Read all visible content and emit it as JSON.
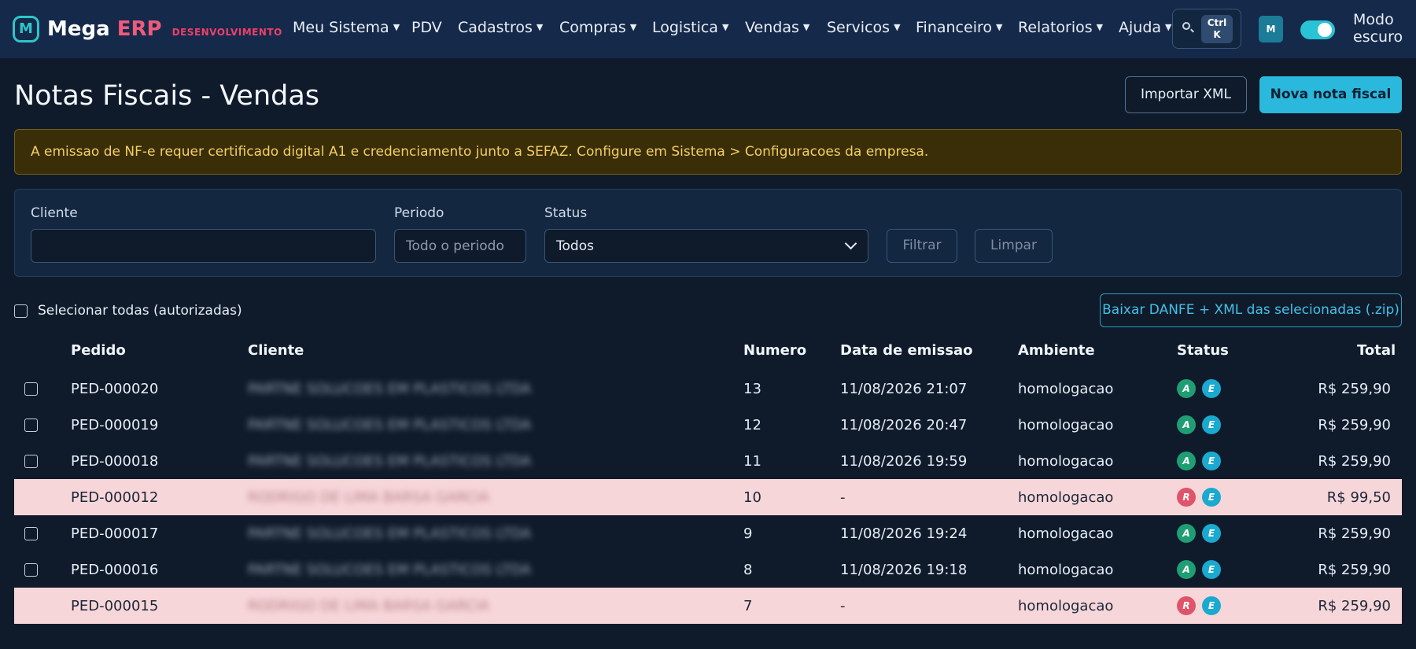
{
  "nav": {
    "brand_main": "Mega",
    "brand_erp": "ERP",
    "brand_env": "DESENVOLVIMENTO",
    "items": [
      {
        "label": "Meu Sistema",
        "dropdown": true
      },
      {
        "label": "PDV",
        "dropdown": false
      },
      {
        "label": "Cadastros",
        "dropdown": true
      },
      {
        "label": "Compras",
        "dropdown": true
      },
      {
        "label": "Logistica",
        "dropdown": true
      },
      {
        "label": "Vendas",
        "dropdown": true
      },
      {
        "label": "Servicos",
        "dropdown": true
      },
      {
        "label": "Financeiro",
        "dropdown": true
      },
      {
        "label": "Relatorios",
        "dropdown": true
      },
      {
        "label": "Ajuda",
        "dropdown": true
      }
    ],
    "shortcut_line1": "Ctrl",
    "shortcut_line2": "K",
    "avatar": "M",
    "dark_mode_label": "Modo escuro",
    "dark_mode_on": true
  },
  "header": {
    "title": "Notas Fiscais - Vendas",
    "import_button": "Importar XML",
    "new_button": "Nova nota fiscal"
  },
  "alert": {
    "text": "A emissao de NF-e requer certificado digital A1 e credenciamento junto a SEFAZ. Configure em Sistema > Configuracoes da empresa."
  },
  "filters": {
    "client_label": "Cliente",
    "client_value": "",
    "period_label": "Periodo",
    "period_placeholder": "Todo o periodo",
    "status_label": "Status",
    "status_value": "Todos",
    "filter_button": "Filtrar",
    "clear_button": "Limpar"
  },
  "bulk": {
    "select_all_label": "Selecionar todas (autorizadas)",
    "download_button": "Baixar DANFE + XML das selecionadas (.zip)"
  },
  "table": {
    "columns": [
      "Pedido",
      "Cliente",
      "Numero",
      "Data de emissao",
      "Ambiente",
      "Status",
      "Total"
    ],
    "rows": [
      {
        "pedido": "PED-000020",
        "cliente": "PARTNE SOLUCOES EM PLASTICOS LTDA",
        "numero": "13",
        "data": "11/08/2026 21:07",
        "ambiente": "homologacao",
        "status": "A",
        "total": "R$ 259,90",
        "rejected": false
      },
      {
        "pedido": "PED-000019",
        "cliente": "PARTNE SOLUCOES EM PLASTICOS LTDA",
        "numero": "12",
        "data": "11/08/2026 20:47",
        "ambiente": "homologacao",
        "status": "A",
        "total": "R$ 259,90",
        "rejected": false
      },
      {
        "pedido": "PED-000018",
        "cliente": "PARTNE SOLUCOES EM PLASTICOS LTDA",
        "numero": "11",
        "data": "11/08/2026 19:59",
        "ambiente": "homologacao",
        "status": "A",
        "total": "R$ 259,90",
        "rejected": false
      },
      {
        "pedido": "PED-000012",
        "cliente": "RODRIGO DE LIMA BARSA GARCIA",
        "numero": "10",
        "data": "-",
        "ambiente": "homologacao",
        "status": "R",
        "total": "R$ 99,50",
        "rejected": true
      },
      {
        "pedido": "PED-000017",
        "cliente": "PARTNE SOLUCOES EM PLASTICOS LTDA",
        "numero": "9",
        "data": "11/08/2026 19:24",
        "ambiente": "homologacao",
        "status": "A",
        "total": "R$ 259,90",
        "rejected": false
      },
      {
        "pedido": "PED-000016",
        "cliente": "PARTNE SOLUCOES EM PLASTICOS LTDA",
        "numero": "8",
        "data": "11/08/2026 19:18",
        "ambiente": "homologacao",
        "status": "A",
        "total": "R$ 259,90",
        "rejected": false
      },
      {
        "pedido": "PED-000015",
        "cliente": "RODRIGO DE LIMA BARSA GARCIA",
        "numero": "7",
        "data": "-",
        "ambiente": "homologacao",
        "status": "R",
        "total": "R$ 259,90",
        "rejected": true
      }
    ],
    "env_badge": "E"
  },
  "colors": {
    "navbar_bg": "#15294a",
    "page_bg": "#0f1b2b",
    "accent": "#2ab8dc",
    "brand_pink": "#ef3f6a",
    "authorized": "#1f9e74",
    "rejected": "#e0546a",
    "rejected_row": "#f7d6da",
    "alert_text": "#f3cf62"
  }
}
